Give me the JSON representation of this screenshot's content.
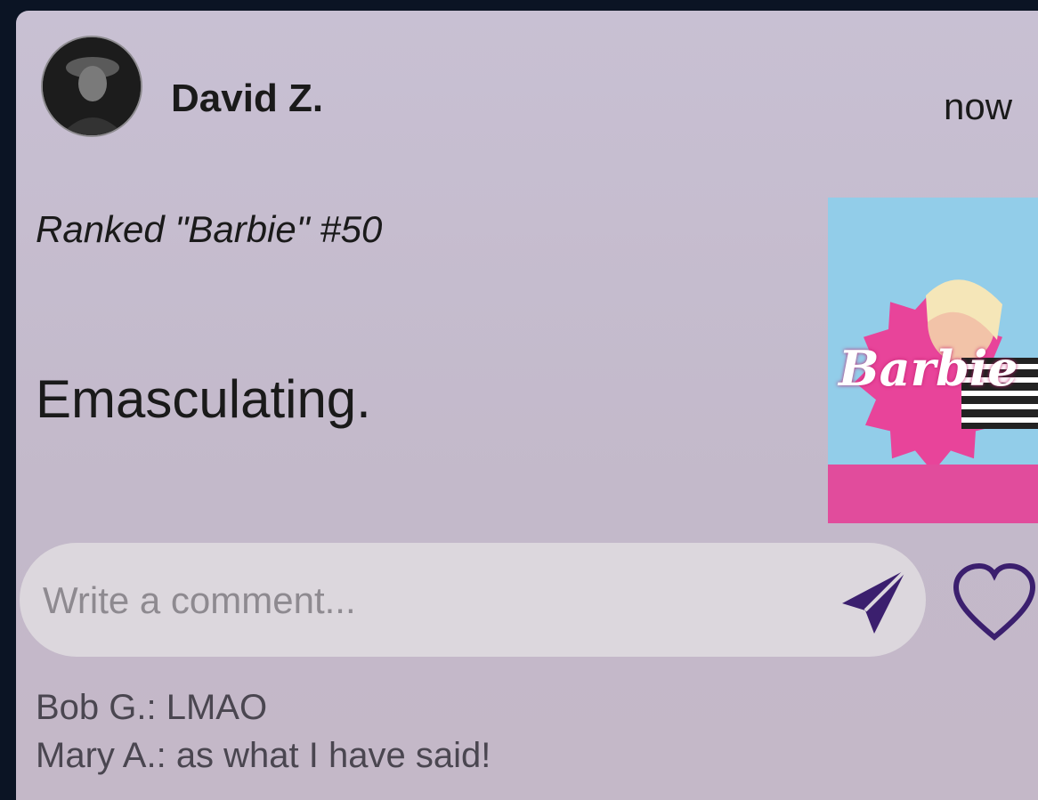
{
  "post": {
    "author": "David Z.",
    "time": "now",
    "subtitle": "Ranked \"Barbie\" #50",
    "review": "Emasculating.",
    "poster_title": "Barbie"
  },
  "comment_field": {
    "placeholder": "Write a comment..."
  },
  "icons": {
    "send": "send-icon",
    "like": "heart-icon"
  },
  "colors": {
    "accent": "#3b1f6e"
  },
  "comments": [
    {
      "text": "Bob G.: LMAO"
    },
    {
      "text": "Mary A.: as what I have said!"
    }
  ]
}
